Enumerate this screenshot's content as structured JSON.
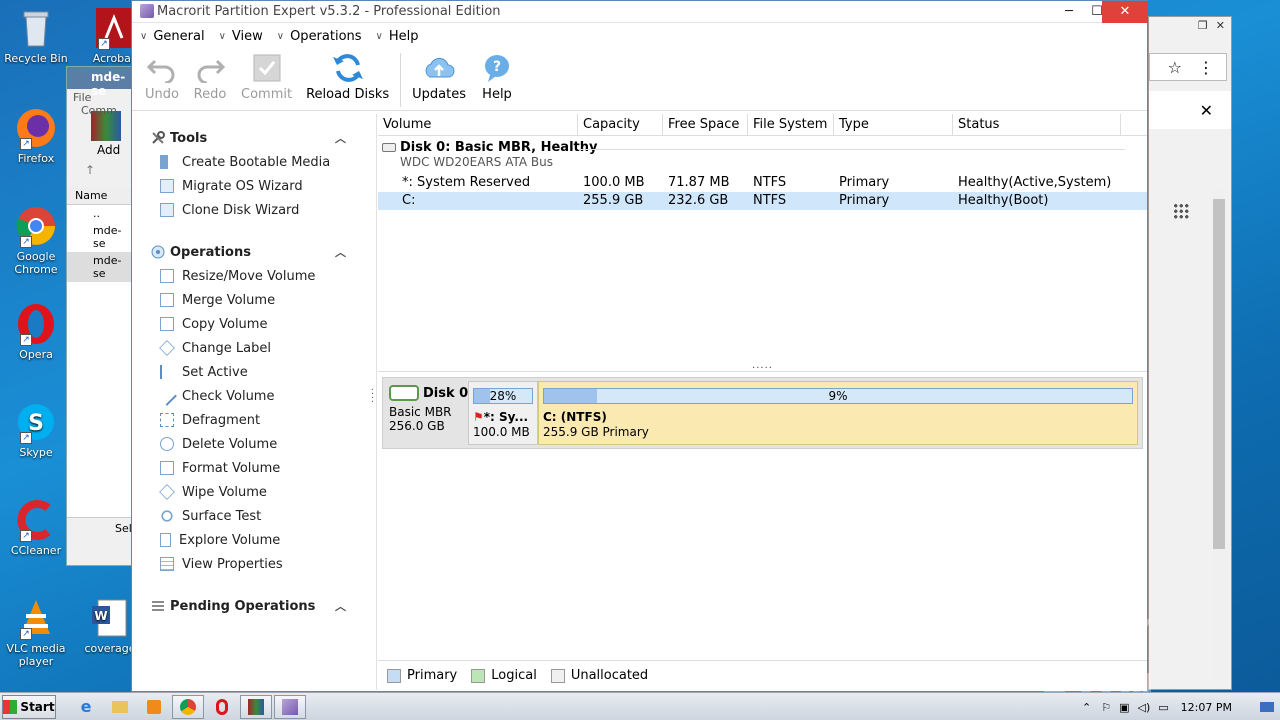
{
  "desktop": {
    "icons": [
      {
        "label": "Recycle Bin"
      },
      {
        "label": "Acrobat"
      },
      {
        "label": "Firefox"
      },
      {
        "label": "Google Chrome"
      },
      {
        "label": "Opera"
      },
      {
        "label": "Skype"
      },
      {
        "label": "CCleaner"
      },
      {
        "label": "VLC media player"
      },
      {
        "label": "coverage"
      }
    ],
    "watermark": "ANY RUN"
  },
  "bg_window": {
    "title": "mde-se",
    "menu_file": "File",
    "menu_comm": "Comm",
    "add_label": "Add",
    "name_col": "Name",
    "rows": [
      "..",
      "mde-se",
      "mde-se"
    ],
    "status": "Sel"
  },
  "window": {
    "title": "Macrorit Partition Expert v5.3.2 - Professional Edition",
    "menus": [
      "General",
      "View",
      "Operations",
      "Help"
    ],
    "toolbar": {
      "undo": "Undo",
      "redo": "Redo",
      "commit": "Commit",
      "reload": "Reload Disks",
      "updates": "Updates",
      "help": "Help"
    }
  },
  "leftpanel": {
    "tools": {
      "title": "Tools",
      "items": [
        "Create Bootable Media",
        "Migrate OS Wizard",
        "Clone Disk Wizard"
      ]
    },
    "operations": {
      "title": "Operations",
      "items": [
        "Resize/Move Volume",
        "Merge Volume",
        "Copy Volume",
        "Change Label",
        "Set Active",
        "Check Volume",
        "Defragment",
        "Delete Volume",
        "Format Volume",
        "Wipe Volume",
        "Surface Test",
        "Explore Volume",
        "View Properties"
      ]
    },
    "pending": {
      "title": "Pending Operations"
    }
  },
  "volume_list": {
    "columns": [
      "Volume",
      "Capacity",
      "Free Space",
      "File System",
      "Type",
      "Status"
    ],
    "disk": {
      "name": "Disk 0: Basic MBR, Healthy",
      "model": "WDC WD20EARS ATA Bus"
    },
    "rows": [
      {
        "volume": "*: System Reserved",
        "capacity": "100.0 MB",
        "free": "71.87 MB",
        "fs": "NTFS",
        "type": "Primary",
        "status": "Healthy(Active,System)"
      },
      {
        "volume": "C:",
        "capacity": "255.9 GB",
        "free": "232.6 GB",
        "fs": "NTFS",
        "type": "Primary",
        "status": "Healthy(Boot)"
      }
    ],
    "splitter": "....."
  },
  "disk_map": {
    "name": "Disk 0",
    "kind": "Basic MBR",
    "size": "256.0 GB",
    "partitions": [
      {
        "percent_label": "28%",
        "used_fraction": 0.28,
        "label": "*: Sy...",
        "size": "100.0 MB"
      },
      {
        "percent_label": "9%",
        "used_fraction": 0.09,
        "label": "C: (NTFS)",
        "size": "255.9 GB Primary"
      }
    ]
  },
  "legend": {
    "primary": "Primary",
    "logical": "Logical",
    "unallocated": "Unallocated",
    "colors": {
      "primary": "#c5dcf4",
      "logical": "#bde6b8",
      "unallocated": "#f0f0f0"
    }
  },
  "taskbar": {
    "start": "Start",
    "clock": "12:07 PM"
  }
}
